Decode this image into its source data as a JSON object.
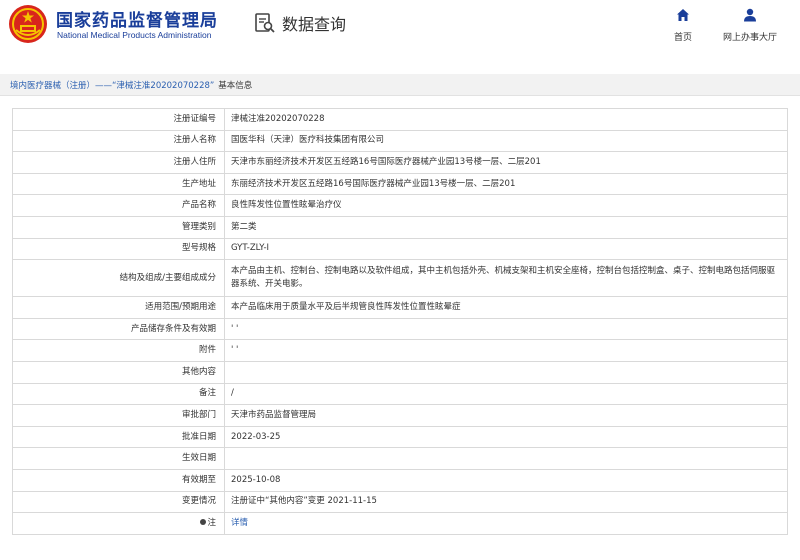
{
  "header": {
    "brand_cn": "国家药品监督管理局",
    "brand_en": "National Medical Products Administration",
    "query_label": "数据查询",
    "nav": [
      {
        "icon": "home-icon",
        "label": "首页"
      },
      {
        "icon": "user-icon",
        "label": "网上办事大厅"
      }
    ]
  },
  "breadcrumb": {
    "link": "境内医疗器械（注册）——“津械注准20202070228”",
    "current": "基本信息"
  },
  "colors": {
    "brand": "#1a3e9a",
    "link": "#2a5fb0",
    "border": "#d9d9d9"
  },
  "rows": [
    {
      "label": "注册证编号",
      "value": "津械注准20202070228"
    },
    {
      "label": "注册人名称",
      "value": "国医华科（天津）医疗科技集团有限公司"
    },
    {
      "label": "注册人住所",
      "value": "天津市东丽经济技术开发区五经路16号国际医疗器械产业园13号楼一层、二层201"
    },
    {
      "label": "生产地址",
      "value": "东丽经济技术开发区五经路16号国际医疗器械产业园13号楼一层、二层201"
    },
    {
      "label": "产品名称",
      "value": "良性阵发性位置性眩晕治疗仪"
    },
    {
      "label": "管理类别",
      "value": "第二类"
    },
    {
      "label": "型号规格",
      "value": "GYT-ZLY-I"
    },
    {
      "label": "结构及组成/主要组成成分",
      "value": "本产品由主机、控制台、控制电路以及软件组成，其中主机包括外壳、机械支架和主机安全座椅，控制台包括控制盒、桌子、控制电路包括伺服驱器系统、开关电影。"
    },
    {
      "label": "适用范围/预期用途",
      "value": "本产品临床用于质量水平及后半规管良性阵发性位置性眩晕症"
    },
    {
      "label": "产品储存条件及有效期",
      "value": "' '"
    },
    {
      "label": "附件",
      "value": "' '"
    },
    {
      "label": "其他内容",
      "value": ""
    },
    {
      "label": "备注",
      "value": "/"
    },
    {
      "label": "审批部门",
      "value": "天津市药品监督管理局"
    },
    {
      "label": "批准日期",
      "value": "2022-03-25"
    },
    {
      "label": "生效日期",
      "value": ""
    },
    {
      "label": "有效期至",
      "value": "2025-10-08"
    },
    {
      "label": "变更情况",
      "value": "注册证中“其他内容”变更 2021-11-15"
    },
    {
      "label": "注",
      "value": "详情"
    }
  ]
}
